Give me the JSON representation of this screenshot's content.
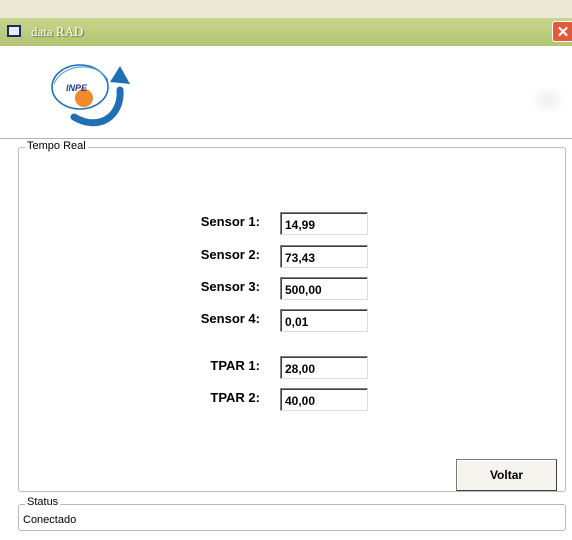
{
  "window": {
    "title": "data RAD",
    "close_glyph": "✕"
  },
  "header": {
    "logo_text": "INPE"
  },
  "realtime": {
    "group_label": "Tempo Real",
    "fields": [
      {
        "label": "Sensor 1:",
        "value": "14,99"
      },
      {
        "label": "Sensor 2:",
        "value": "73,43"
      },
      {
        "label": "Sensor 3:",
        "value": "500,00"
      },
      {
        "label": "Sensor 4:",
        "value": "0,01"
      },
      {
        "label": "TPAR 1:",
        "value": "28,00"
      },
      {
        "label": "TPAR 2:",
        "value": "40,00"
      }
    ],
    "back_button": "Voltar"
  },
  "status": {
    "group_label": "Status",
    "text": "Conectado"
  },
  "colors": {
    "titlebar": "#b3c473",
    "close_button": "#e05a3e",
    "logo_blue": "#1f6fb5",
    "logo_orange": "#f08a2c"
  },
  "icons": {
    "window_icon": "window-icon",
    "close": "close-icon"
  }
}
